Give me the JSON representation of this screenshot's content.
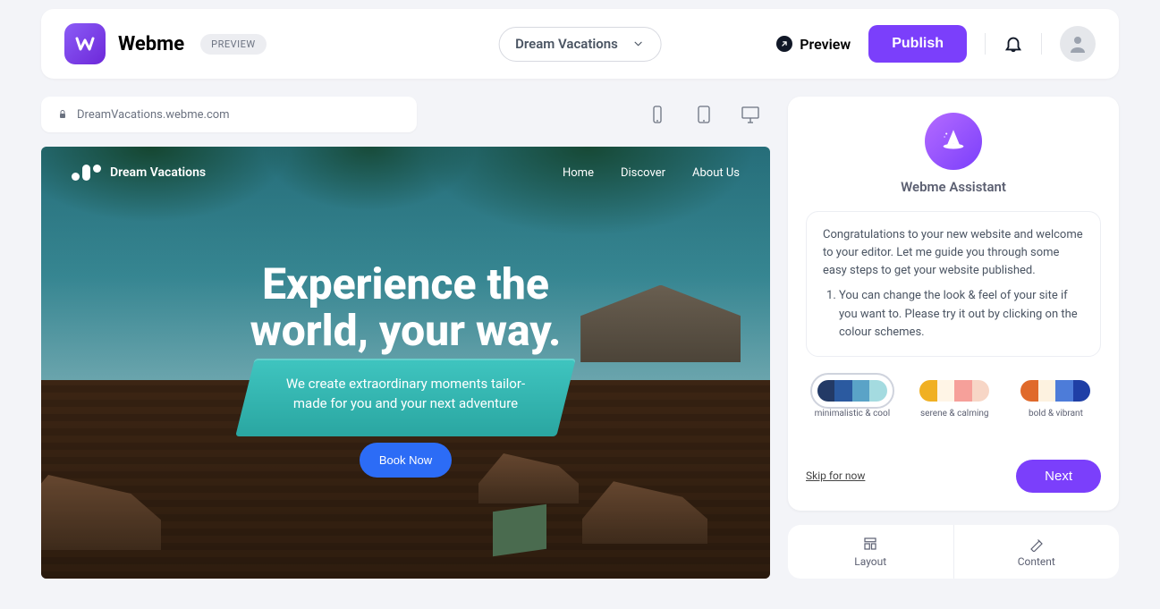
{
  "brand": {
    "name": "Webme",
    "mode_badge": "PREVIEW"
  },
  "header": {
    "project_selector": "Dream Vacations",
    "preview_link": "Preview",
    "publish_button": "Publish"
  },
  "address_bar": {
    "url": "DreamVacations.webme.com"
  },
  "site": {
    "name": "Dream Vacations",
    "nav": {
      "home": "Home",
      "discover": "Discover",
      "about": "About Us"
    },
    "hero": {
      "title_line1": "Experience the",
      "title_line2": "world, your way.",
      "subtitle_line1": "We create extraordinary moments tailor-",
      "subtitle_line2": "made for you and your next adventure",
      "cta": "Book Now"
    }
  },
  "assistant": {
    "title": "Webme Assistant",
    "greeting": "Congratulations to your new website and welcome to your editor. Let me guide you through some easy steps to get your website published.",
    "step1": "You can change the look & feel of your site if you want to. Please try it out by clicking on the colour schemes.",
    "schemes": [
      {
        "id": "minimal",
        "label": "minimalistic & cool",
        "colors": [
          "#233a66",
          "#2b5aa0",
          "#5aa3c7",
          "#a4dbe0"
        ],
        "active": true
      },
      {
        "id": "serene",
        "label": "serene & calming",
        "colors": [
          "#f0b023",
          "#fff5e6",
          "#f6a09a",
          "#f7d6c6"
        ],
        "active": false
      },
      {
        "id": "bold",
        "label": "bold & vibrant",
        "colors": [
          "#e06a2b",
          "#fdf2e0",
          "#4d7cd9",
          "#1f3fa6"
        ],
        "active": false
      }
    ],
    "skip": "Skip for now",
    "next": "Next"
  },
  "bottom_tabs": {
    "layout": "Layout",
    "content": "Content"
  }
}
